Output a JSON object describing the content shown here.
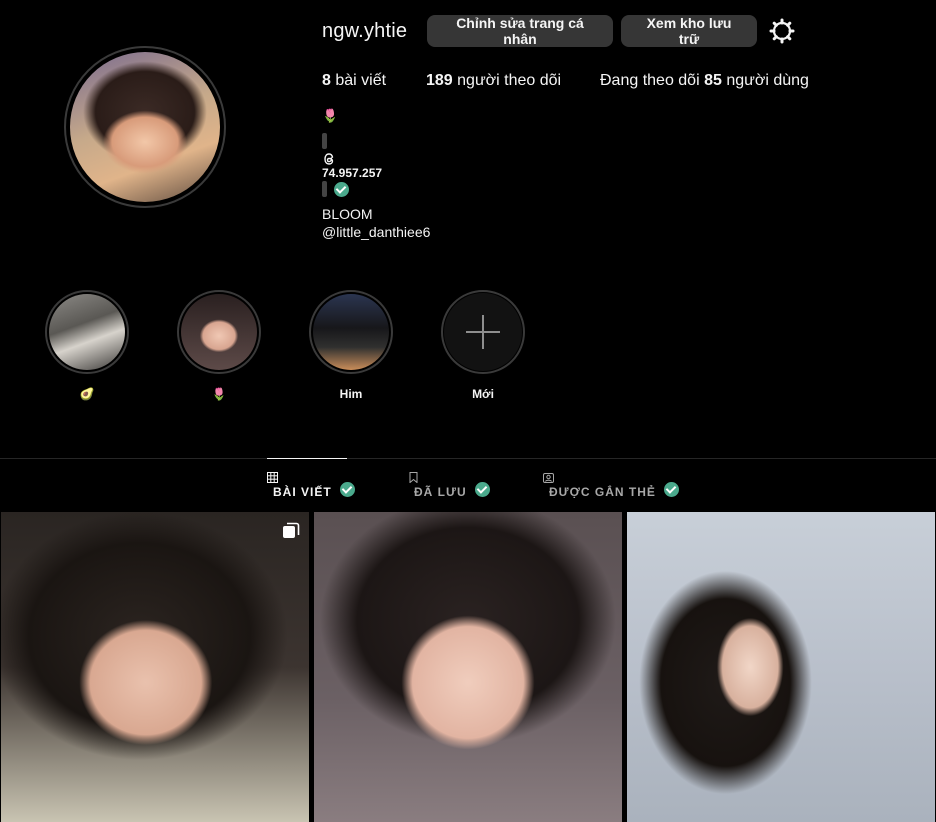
{
  "profile": {
    "username": "ngw.yhtie",
    "edit_label": "Chỉnh sửa trang cá nhân",
    "archive_label": "Xem kho lưu trữ",
    "settings_icon": "gear-icon"
  },
  "stats": {
    "posts_count": "8",
    "posts_label": "bài viết",
    "followers_count": "189",
    "followers_label": "người theo dõi",
    "following_prefix": "Đang theo dõi",
    "following_count": "85",
    "following_label": "người dùng"
  },
  "bio": {
    "emoji": "🌷",
    "threads_icon": "threads-icon",
    "threads_count": "74.957.257",
    "verified_icon": "check-icon",
    "name": "BLOOM",
    "handle": "@little_danthiee6"
  },
  "highlights": [
    {
      "label": "🥑"
    },
    {
      "label": "🌷"
    },
    {
      "label": "Him"
    },
    {
      "label": "Mới"
    }
  ],
  "tabs": [
    {
      "label": "BÀI VIẾT",
      "icon": "grid-icon",
      "active": true
    },
    {
      "label": "ĐÃ LƯU",
      "icon": "bookmark-icon",
      "active": false
    },
    {
      "label": "ĐƯỢC GẮN THẺ",
      "icon": "tagged-icon",
      "active": false
    }
  ],
  "colors": {
    "background": "#000000",
    "button_bg": "#363636",
    "verified": "#4aa98c",
    "muted": "#a8a8a8"
  }
}
